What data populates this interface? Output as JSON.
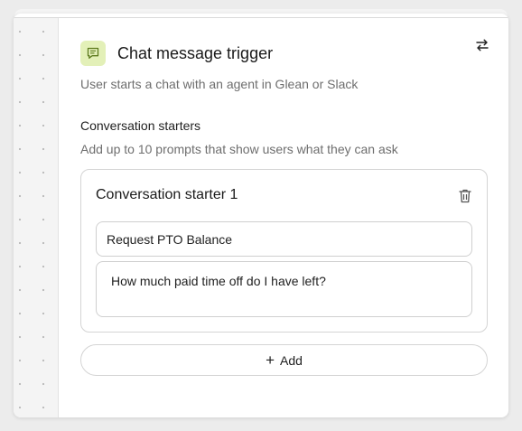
{
  "trigger": {
    "icon": "chat-message-icon",
    "title": "Chat message trigger",
    "subtitle": "User starts a chat with an agent in Glean or Slack",
    "swap_icon": "swap-arrows-icon",
    "icon_bg_color": "#e3f0b8",
    "icon_color": "#5d7a1e"
  },
  "conversation_starters": {
    "label": "Conversation starters",
    "help": "Add up to 10 prompts that show users what they can ask",
    "items": [
      {
        "title": "Conversation starter 1",
        "name_value": "Request PTO Balance",
        "prompt_value": "How much paid time off do I have left?",
        "delete_icon": "trash-icon"
      }
    ],
    "add_button": {
      "icon": "+",
      "label": "Add"
    }
  }
}
